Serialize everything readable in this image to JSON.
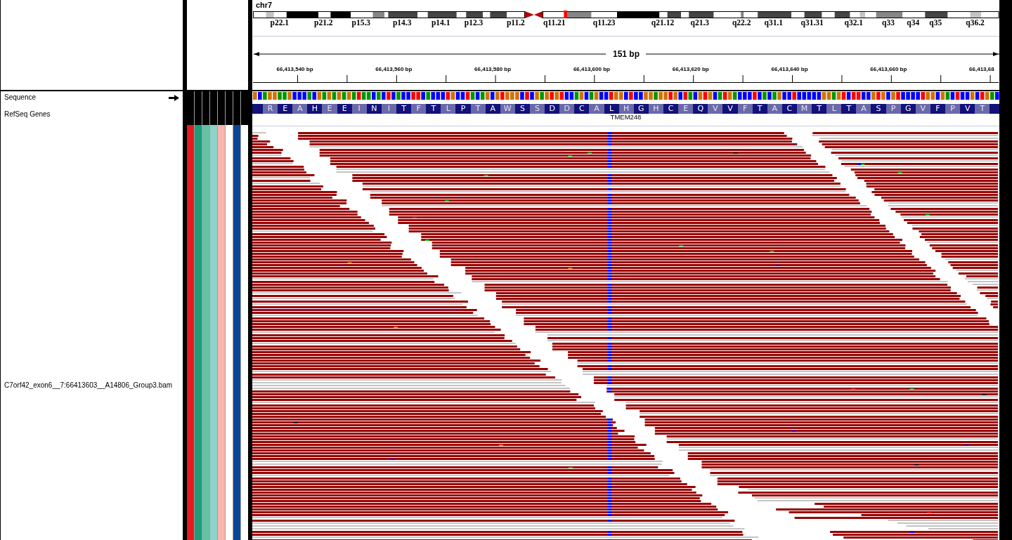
{
  "header": {
    "chromosome": "chr7",
    "band_labels": [
      "p22.1",
      "p21.2",
      "p15.3",
      "p14.3",
      "p14.1",
      "p12.3",
      "p11.2",
      "q11.21",
      "q11.23",
      "q21.12",
      "q21.3",
      "q22.2",
      "q31.1",
      "q31.31",
      "q32.1",
      "q33",
      "q34",
      "q35",
      "q36.2"
    ],
    "ruler": {
      "span": "151 bp",
      "tick_labels": [
        "66,413,540 bp",
        "66,413,560 bp",
        "66,413,580 bp",
        "66,413,600 bp",
        "66,413,620 bp",
        "66,413,640 bp",
        "66,413,660 bp",
        "66,413,68"
      ]
    }
  },
  "attributes": [
    {
      "color": "#e41a1c"
    },
    {
      "color": "#1b9e77"
    },
    {
      "color": "#66c2a5"
    },
    {
      "color": "#8dd3c7"
    },
    {
      "color": "#fbb4ae"
    },
    {
      "color": "#ffffff"
    },
    {
      "color": "#0b4595"
    },
    {
      "color": "#ffffff"
    }
  ],
  "tracks": [
    {
      "kind": "sequence",
      "name": "Sequence",
      "forward_strand": true
    },
    {
      "kind": "gene",
      "name": "RefSeq Genes",
      "gene": "TMEM248",
      "amino_acids": [
        "R",
        "E",
        "A",
        "H",
        "E",
        "E",
        "I",
        "N",
        "I",
        "T",
        "F",
        "T",
        "L",
        "P",
        "T",
        "A",
        "W",
        "S",
        "S",
        "D",
        "D",
        "C",
        "A",
        "L",
        "H",
        "G",
        "H",
        "C",
        "E",
        "Q",
        "V",
        "V",
        "F",
        "T",
        "A",
        "C",
        "M",
        "T",
        "L",
        "T",
        "A",
        "S",
        "P",
        "G",
        "V",
        "F",
        "P",
        "V",
        "T"
      ]
    },
    {
      "kind": "alignment",
      "name": "C7orf42_exon6__7:66413603__A14806_Group3.bam"
    }
  ]
}
